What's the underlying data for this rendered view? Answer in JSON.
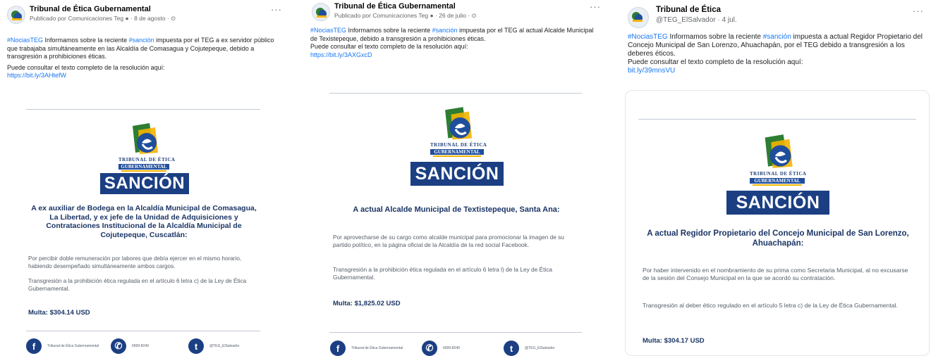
{
  "colors": {
    "brand_blue": "#1b3f82",
    "link_blue": "#1877f2",
    "emblem_green": "#2e7d32",
    "emblem_yellow": "#f4b400"
  },
  "posts": [
    {
      "author": "Tribunal de Ética Gubernamental",
      "meta": "Publicado por Comunicaciones Teg ",
      "date": " · 8 de agosto · ",
      "more": "···",
      "hashtag": "#NociasTEG",
      "text1": " Informamos sobre la reciente ",
      "hashtag2": "#sanción",
      "text2": " impuesta por el TEG a ex servidor público que trabajaba simultáneamente en las Alcaldía de Comasagua y Cojutepeque, debido a transgresión a prohibiciones éticas.",
      "consult": "Puede consultar el texto completo de la resolución aquí:",
      "link": "https://bit.ly/3AHtefW",
      "card": {
        "logo_line1": "TRIBUNAL DE ÉTICA",
        "logo_line2": "GUBERNAMENTAL",
        "badge": "SANCIÓN",
        "title": "A ex auxiliar de Bodega en la Alcaldía Municipal de Comasagua, La Libertad, y ex jefe de la Unidad de Adquisiciones y Contrataciones Institucional de la Alcaldía Municipal de Cojutepeque, Cuscatlán:",
        "para1": "Por percibir doble remuneración por labores que debía ejercer en el mismo horario, habiendo desempeñado simultáneamente ambos cargos.",
        "para2": "Transgresión a la prohibición ética regulada en el artículo 6 letra c) de la Ley de Ética Gubernamental.",
        "multa": "Multa: $304.14 USD",
        "foot_fb": "Tribunal de Ética Gubernamental",
        "foot_wa": "6999-8240",
        "foot_tw": "@TEG_ElSalvador"
      }
    },
    {
      "author": "Tribunal de Ética Gubernamental",
      "meta": "Publicado por Comunicaciones Teg ",
      "date": " · 26 de julio · ",
      "more": "···",
      "hashtag": "#NociasTEG",
      "text1": " Informamos sobre la reciente ",
      "hashtag2": "#sanción",
      "text2": " impuesta por el TEG al actual Alcalde Municipal de Texistepeque, debido a transgresión a prohibiciones éticas.",
      "consult": "Puede consultar el texto completo de la resolución aquí:",
      "link": "https://bit.ly/3AXGxcD",
      "card": {
        "logo_line1": "TRIBUNAL DE ÉTICA",
        "logo_line2": "GUBERNAMENTAL",
        "badge": "SANCIÓN",
        "title": "A actual Alcalde Municipal de Textistepeque, Santa Ana:",
        "para1": "Por aprovecharse de su cargo como alcalde municipal para promocionar la imagen de su partido político, en la página oficial de la Alcaldía de la red social Facebook.",
        "para2": "Transgresión a la prohibición ética regulada en el artículo 6 letra l) de la Ley de Ética Gubernamental.",
        "multa": "Multa: $1,825.02 USD",
        "foot_fb": "Tribunal de Ética Gubernamental",
        "foot_wa": "6999-8240",
        "foot_tw": "@TEG_ElSalvador"
      }
    },
    {
      "author": "Tribunal de Ética",
      "handle": "@TEG_ElSalvador · 4 jul.",
      "more": "···",
      "hashtag": "#NociasTEG",
      "text1": " Informamos sobre la reciente ",
      "hashtag2": "#sanción",
      "text2": " impuesta a actual Regidor Propietario del Concejo Municipal de San Lorenzo, Ahuachapán, por el TEG debido a transgresión a los deberes éticos.",
      "consult": "Puede consultar el texto completo de la resolución aquí:",
      "link": "bit.ly/39mnsVU",
      "card": {
        "logo_line1": "TRIBUNAL DE ÉTICA",
        "logo_line2": "GUBERNAMENTAL",
        "badge": "SANCIÓN",
        "title": "A actual Regidor Propietario del Concejo Municipal de San Lorenzo, Ahuachapán:",
        "para1": "Por haber intervenido en el nombramiento de su prima como Secretaria Municipal, al no excusarse de la sesión del Consejo Municipal en la que se acordó su contratación.",
        "para2": "Transgresión al deber ético regulado en el artículo 5 letra c) de la Ley de Ética Gubernamental.",
        "multa": "Multa: $304.17 USD"
      }
    }
  ]
}
